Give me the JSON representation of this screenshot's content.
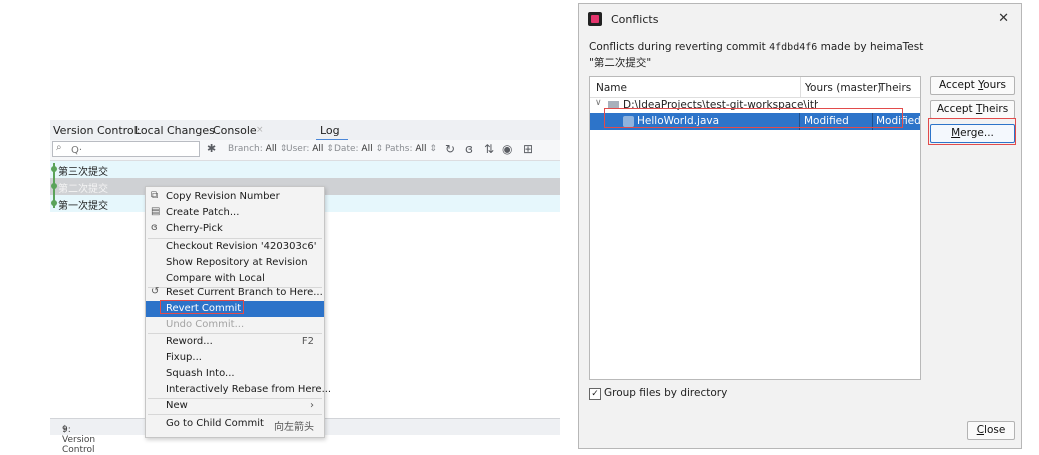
{
  "vc": {
    "tabs": [
      "Version Control:",
      "Local Changes",
      "Console",
      "Log"
    ],
    "filter_placeholder": "Q·",
    "filters": {
      "branch": {
        "label": "Branch:",
        "value": "All"
      },
      "user": {
        "label": "User:",
        "value": "All"
      },
      "date": {
        "label": "Date:",
        "value": "All"
      },
      "paths": {
        "label": "Paths:",
        "value": "All"
      }
    },
    "commits": [
      "第三次提交",
      "第二次提交",
      "第一次提交"
    ],
    "status": "9: Version Control"
  },
  "menu": {
    "items": [
      {
        "label": "Copy Revision Number",
        "icon": "copy-icon"
      },
      {
        "label": "Create Patch...",
        "icon": "patch-icon"
      },
      {
        "label": "Cherry-Pick",
        "icon": "cherry-pick-icon"
      },
      {
        "label": "Checkout Revision '420303c6'"
      },
      {
        "label": "Show Repository at Revision"
      },
      {
        "label": "Compare with Local"
      },
      {
        "label": "Reset Current Branch to Here...",
        "icon": "reset-icon"
      },
      {
        "label": "Revert Commit"
      },
      {
        "label": "Undo Commit..."
      },
      {
        "label": "Reword...",
        "shortcut": "F2"
      },
      {
        "label": "Fixup..."
      },
      {
        "label": "Squash Into..."
      },
      {
        "label": "Interactively Rebase from Here..."
      },
      {
        "label": "New"
      },
      {
        "label": "Go to Child Commit",
        "shortcut": "向左箭头"
      }
    ]
  },
  "dialog": {
    "title": "Conflicts",
    "desc_prefix": "Conflicts during reverting commit",
    "commit_hash": "4fdbd4f6",
    "desc_suffix": "made by heimaTest",
    "commit_message": "\"第二次提交\"",
    "columns": [
      "Name",
      "Yours (master)",
      "Theirs"
    ],
    "directory": "D:\\IdeaProjects\\test-git-workspace\\ithe",
    "file": {
      "name": "HelloWorld.java",
      "yours": "Modified",
      "theirs": "Modified"
    },
    "group_files_label": "Group files by directory",
    "buttons": {
      "accept_yours_pre": "Accept ",
      "accept_yours_key": "Y",
      "accept_yours_post": "ours",
      "accept_theirs_pre": "Accept ",
      "accept_theirs_key": "T",
      "accept_theirs_post": "heirs",
      "merge_key": "M",
      "merge_post": "erge...",
      "close_key": "C",
      "close_post": "lose"
    }
  },
  "colors": {
    "selection": "#2d74c9",
    "highlight": "#e24b4b",
    "graph": "#5aa35a"
  }
}
